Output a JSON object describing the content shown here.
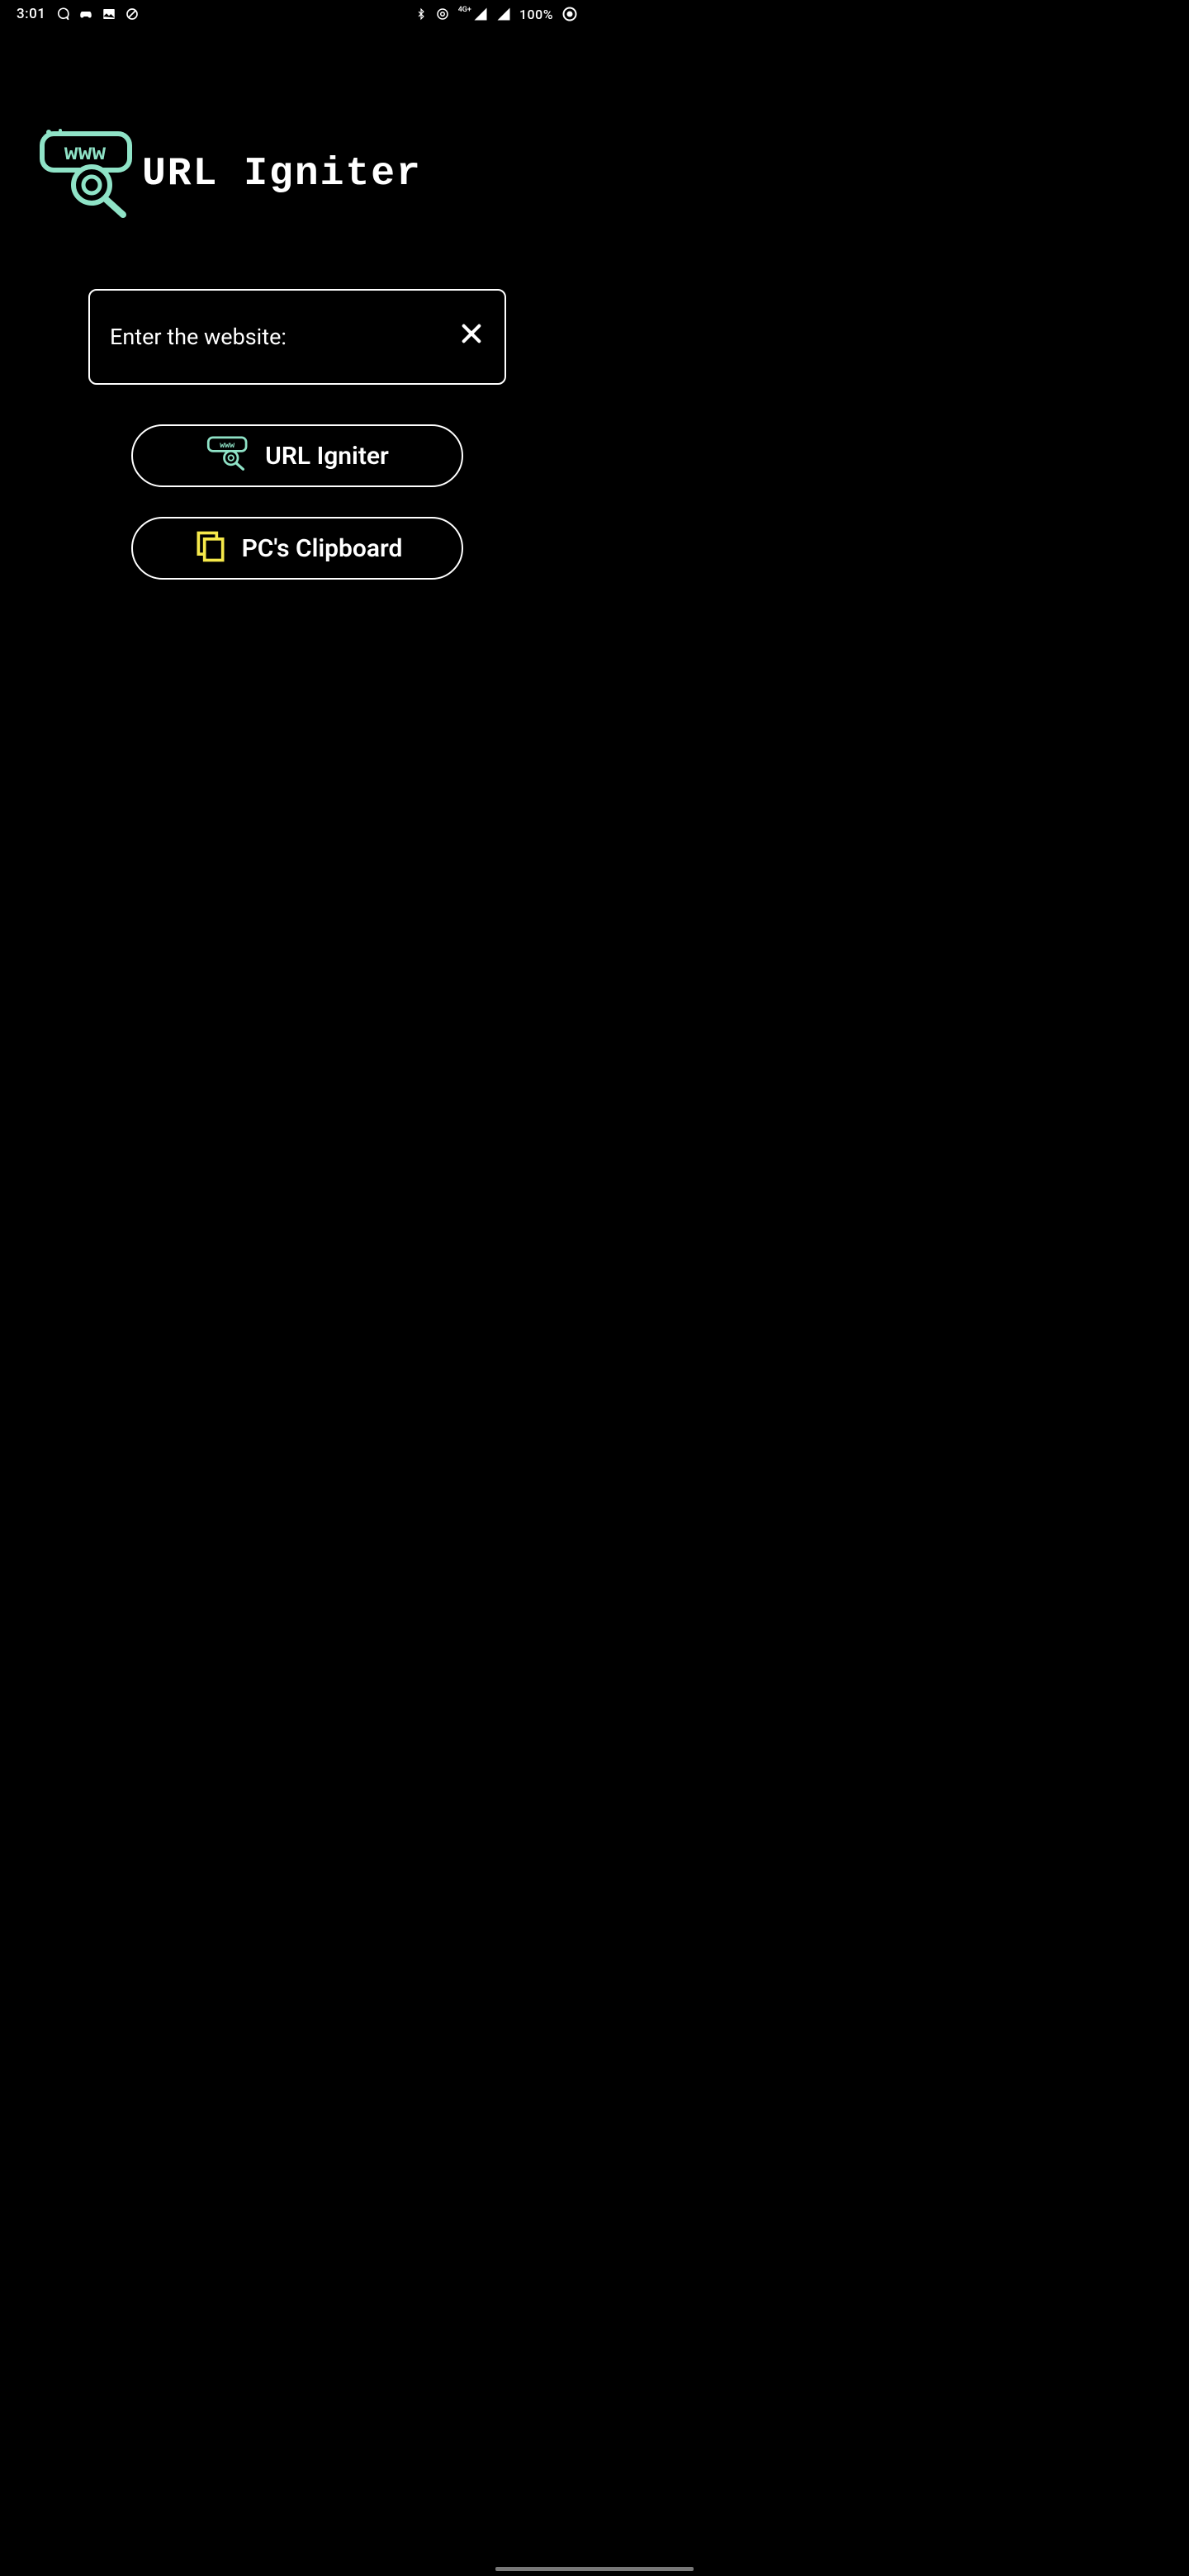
{
  "statusbar": {
    "time": "3:01",
    "network_label": "4G+",
    "battery_text": "100%"
  },
  "app": {
    "title": "URL Igniter"
  },
  "input": {
    "placeholder": "Enter the website:"
  },
  "buttons": {
    "ignite_label": "URL Igniter",
    "clipboard_label": "PC's Clipboard"
  },
  "colors": {
    "accent_green": "#8fe3c7",
    "accent_yellow": "#f6e94a"
  }
}
